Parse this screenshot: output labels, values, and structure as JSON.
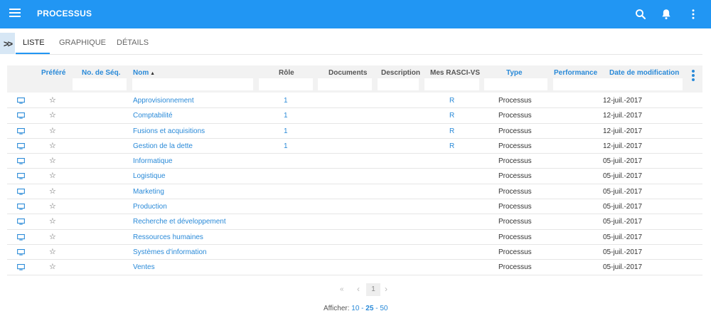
{
  "header": {
    "title": "PROCESSUS"
  },
  "tabs": [
    "LISTE",
    "GRAPHIQUE",
    "DÉTAILS"
  ],
  "columns": {
    "prefere": "Préféré",
    "seq": "No. de Séq.",
    "nom": "Nom",
    "role": "Rôle",
    "documents": "Documents",
    "description": "Description",
    "rasci": "Mes RASCI-VS",
    "type": "Type",
    "performance": "Performance",
    "date": "Date de modification"
  },
  "rows": [
    {
      "nom": "Approvisionnement",
      "role": "1",
      "rasci": "R",
      "type": "Processus",
      "date": "12-juil.-2017"
    },
    {
      "nom": "Comptabilité",
      "role": "1",
      "rasci": "R",
      "type": "Processus",
      "date": "12-juil.-2017"
    },
    {
      "nom": "Fusions et acquisitions",
      "role": "1",
      "rasci": "R",
      "type": "Processus",
      "date": "12-juil.-2017"
    },
    {
      "nom": "Gestion de la dette",
      "role": "1",
      "rasci": "R",
      "type": "Processus",
      "date": "12-juil.-2017"
    },
    {
      "nom": "Informatique",
      "role": "",
      "rasci": "",
      "type": "Processus",
      "date": "05-juil.-2017"
    },
    {
      "nom": "Logistique",
      "role": "",
      "rasci": "",
      "type": "Processus",
      "date": "05-juil.-2017"
    },
    {
      "nom": "Marketing",
      "role": "",
      "rasci": "",
      "type": "Processus",
      "date": "05-juil.-2017"
    },
    {
      "nom": "Production",
      "role": "",
      "rasci": "",
      "type": "Processus",
      "date": "05-juil.-2017"
    },
    {
      "nom": "Recherche et développement",
      "role": "",
      "rasci": "",
      "type": "Processus",
      "date": "05-juil.-2017"
    },
    {
      "nom": "Ressources humaines",
      "role": "",
      "rasci": "",
      "type": "Processus",
      "date": "05-juil.-2017"
    },
    {
      "nom": "Systèmes d'information",
      "role": "",
      "rasci": "",
      "type": "Processus",
      "date": "05-juil.-2017"
    },
    {
      "nom": "Ventes",
      "role": "",
      "rasci": "",
      "type": "Processus",
      "date": "05-juil.-2017"
    }
  ],
  "pagination": {
    "first": "«",
    "prev": "‹",
    "current": "1",
    "next": "›",
    "show_label": "Afficher:",
    "sizes": [
      "10",
      "25",
      "50"
    ],
    "selected_size": "25"
  },
  "colors": {
    "primary": "#2196f3",
    "link": "#2a8ad8"
  },
  "icons": [
    "menu-icon",
    "search-icon",
    "bell-icon",
    "more-vert-icon",
    "expand-icon",
    "monitor-icon",
    "star-icon"
  ]
}
